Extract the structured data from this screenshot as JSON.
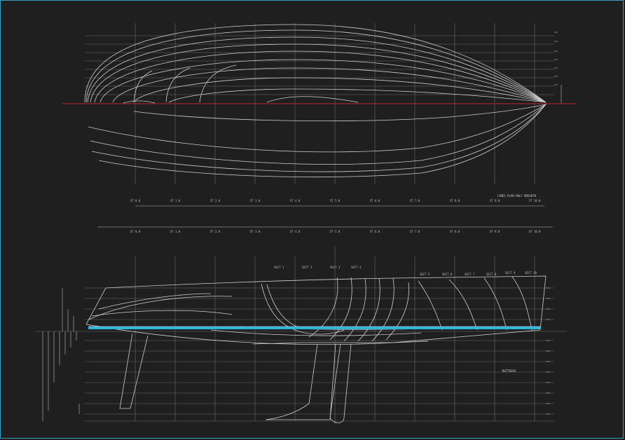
{
  "drawing": {
    "colors": {
      "background": "#1f1f1f",
      "border": "#3a9fbf",
      "lines": "#cfcfcf",
      "grid": "#6a6a6a",
      "plan_centerline": "#c0282a",
      "profile_waterline": "#2fb4d8"
    },
    "plan_view": {
      "station_labels": [
        "ST 0.0",
        "ST 1.0",
        "ST 2.0",
        "ST 3.0",
        "ST 4.0",
        "ST 5.0",
        "ST 6.0",
        "ST 7.0",
        "ST 8.0",
        "ST 9.0",
        "ST 10.0"
      ],
      "scale_note": "LINES PLAN HALF BREADTH"
    },
    "station_bar": {
      "labels": [
        "ST 0.0",
        "ST 1.0",
        "ST 2.0",
        "ST 3.0",
        "ST 4.0",
        "ST 5.0",
        "ST 6.0",
        "ST 7.0",
        "ST 8.0",
        "ST 9.0",
        "ST 10.0"
      ]
    },
    "profile_view": {
      "section_labels": [
        "SECT 1",
        "SECT 2",
        "SECT 3",
        "SECT 4",
        "SECT 5",
        "SECT 6",
        "SECT 7",
        "SECT 8",
        "SECT 9",
        "SECT 10"
      ],
      "note": "BUTTOCKS"
    }
  }
}
